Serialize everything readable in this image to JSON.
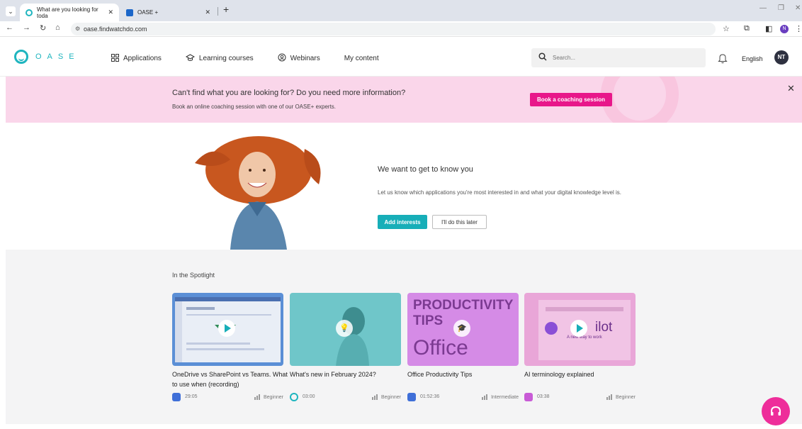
{
  "browser": {
    "tabs": [
      {
        "title": "What are you looking for toda",
        "active": true
      },
      {
        "title": "OASE +",
        "active": false
      }
    ],
    "url": "oase.findwatchdo.com"
  },
  "header": {
    "logo_text": "OASE",
    "nav": [
      {
        "label": "Applications",
        "icon": "grid-icon"
      },
      {
        "label": "Learning courses",
        "icon": "graduation-cap-icon"
      },
      {
        "label": "Webinars",
        "icon": "webinar-icon"
      },
      {
        "label": "My content",
        "icon": ""
      }
    ],
    "search_placeholder": "Search...",
    "language": "English",
    "avatar_initials": "NT"
  },
  "banner": {
    "title": "Can't find what you are looking for? Do you need more information?",
    "subtitle": "Book an online coaching session with one of our OASE+ experts.",
    "button": "Book a coaching session"
  },
  "hero": {
    "title": "We want to get to know you",
    "text": "Let us know which applications you're most interested in and what your digital knowledge level is.",
    "primary_button": "Add interests",
    "secondary_button": "I'll do this later"
  },
  "spotlight": {
    "title": "In the Spotlight",
    "cards": [
      {
        "title": "OneDrive vs SharePoint vs Teams. What to use when (recording)",
        "duration": "29:05",
        "level": "Beginner",
        "app_color": "#3f6fd8"
      },
      {
        "title": "What's new in February 2024?",
        "duration": "03:00",
        "level": "Beginner",
        "app_color": "#1fb5bf"
      },
      {
        "title": "Office Productivity Tips",
        "duration": "01:52:36",
        "level": "Intermediate",
        "app_color": "#3f6fd8"
      },
      {
        "title": "AI terminology explained",
        "duration": "03:38",
        "level": "Beginner",
        "app_color": "#c85bd6"
      }
    ],
    "thumb_text": {
      "productivity_line1": "PRODUCTIVITY",
      "productivity_line2": "TIPS",
      "productivity_line3": "Office",
      "copilot_word": "ilot",
      "copilot_tag": "A new way to work"
    }
  },
  "colors": {
    "accent": "#17aeb8",
    "pink": "#e8178a",
    "banner_bg": "#fad6ea"
  }
}
